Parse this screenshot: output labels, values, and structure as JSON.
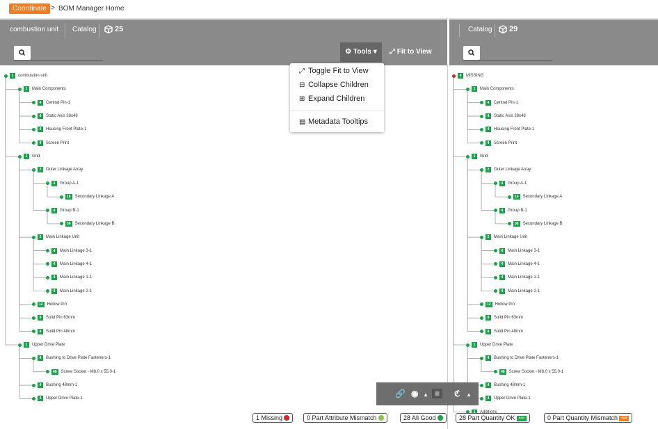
{
  "breadcrumb": {
    "app": "Coordinate",
    "separator": ">",
    "page": "BOM Manager Home"
  },
  "left_panel": {
    "title": "combustion unit",
    "catalog_label": "Catalog",
    "count": "25",
    "tools_label": "Tools",
    "fit_label": "Fit to View"
  },
  "right_panel": {
    "catalog_label": "Catalog",
    "count": "29"
  },
  "menu": {
    "items": [
      "Toggle Fit to View",
      "Collapse Children",
      "Expand Children",
      "Metadata Tooltips"
    ]
  },
  "colors": {
    "accent": "#f47b20",
    "ok": "#1aa34a",
    "missing": "#d9232a",
    "mismatch_dot": "#8bc34a",
    "header": "#8a8a8a"
  },
  "left_tree": [
    {
      "b": "1",
      "t": "combustion unit",
      "d": 0
    },
    {
      "b": "1",
      "t": "Main Components",
      "d": 1
    },
    {
      "b": "4",
      "t": "Central Pin-1",
      "d": 2
    },
    {
      "b": "4",
      "t": "Static Axis 28x48",
      "d": 2
    },
    {
      "b": "4",
      "t": "Housing Front Plate-1",
      "d": 2
    },
    {
      "b": "4",
      "t": "Screen Print",
      "d": 2
    },
    {
      "b": "1",
      "t": "Grid",
      "d": 1
    },
    {
      "b": "2",
      "t": "Outer Linkage Array",
      "d": 2
    },
    {
      "b": "4",
      "t": "Group A-1",
      "d": 3
    },
    {
      "b": "16",
      "t": "Secondary Linkage A",
      "d": 4
    },
    {
      "b": "4",
      "t": "Group B-1",
      "d": 3
    },
    {
      "b": "36",
      "t": "Secondary Linkage B",
      "d": 4
    },
    {
      "b": "2",
      "t": "Main Linkage Unit",
      "d": 2
    },
    {
      "b": "4",
      "t": "Main Linkage 3-1",
      "d": 3
    },
    {
      "b": "4",
      "t": "Main Linkage 4-1",
      "d": 3
    },
    {
      "b": "4",
      "t": "Main Linkage 1-1",
      "d": 3
    },
    {
      "b": "4",
      "t": "Main Linkage 2-1",
      "d": 3
    },
    {
      "b": "12",
      "t": "Hollow Pin",
      "d": 2
    },
    {
      "b": "8",
      "t": "Solid Pin 63mm",
      "d": 2
    },
    {
      "b": "8",
      "t": "Solid Pin 48mm",
      "d": 2
    },
    {
      "b": "1",
      "t": "Upper Drive Plate",
      "d": 1
    },
    {
      "b": "4",
      "t": "Bushing to Drive Plate Fasteners-1",
      "d": 2
    },
    {
      "b": "48",
      "t": "Screw Socket - M8.0 x 55.0-1",
      "d": 3
    },
    {
      "b": "4",
      "t": "Bushing 48mm-1",
      "d": 2
    },
    {
      "b": "4",
      "t": "Upper Drive Plate-1",
      "d": 2
    }
  ],
  "right_tree": [
    {
      "b": "0",
      "t": "MISSING",
      "d": 0
    },
    {
      "b": "1",
      "t": "Main Components",
      "d": 1
    },
    {
      "b": "4",
      "t": "Central Pin-1",
      "d": 2
    },
    {
      "b": "4",
      "t": "Static Axis 28x48",
      "d": 2
    },
    {
      "b": "4",
      "t": "Housing Front Plate-1",
      "d": 2
    },
    {
      "b": "4",
      "t": "Screen Print",
      "d": 2
    },
    {
      "b": "1",
      "t": "Grid",
      "d": 1
    },
    {
      "b": "2",
      "t": "Outer Linkage Array",
      "d": 2
    },
    {
      "b": "4",
      "t": "Group A-1",
      "d": 3
    },
    {
      "b": "16",
      "t": "Secondary Linkage A",
      "d": 4
    },
    {
      "b": "4",
      "t": "Group B-1",
      "d": 3
    },
    {
      "b": "36",
      "t": "Secondary Linkage B",
      "d": 4
    },
    {
      "b": "2",
      "t": "Main Linkage Unit",
      "d": 2
    },
    {
      "b": "4",
      "t": "Main Linkage 3-1",
      "d": 3
    },
    {
      "b": "4",
      "t": "Main Linkage 4-1",
      "d": 3
    },
    {
      "b": "4",
      "t": "Main Linkage 1-1",
      "d": 3
    },
    {
      "b": "4",
      "t": "Main Linkage 2-1",
      "d": 3
    },
    {
      "b": "12",
      "t": "Hollow Pin",
      "d": 2
    },
    {
      "b": "8",
      "t": "Solid Pin 63mm",
      "d": 2
    },
    {
      "b": "8",
      "t": "Solid Pin 48mm",
      "d": 2
    },
    {
      "b": "1",
      "t": "Upper Drive Plate",
      "d": 1
    },
    {
      "b": "4",
      "t": "Bushing to Drive Plate Fasteners-1",
      "d": 2
    },
    {
      "b": "48",
      "t": "Screw Socket - M8.0 x 55.0-1",
      "d": 3
    },
    {
      "b": "4",
      "t": "Bushing 48mm-1",
      "d": 2
    },
    {
      "b": "4",
      "t": "Upper Drive Plate-1",
      "d": 2
    },
    {
      "b": "1",
      "t": "Additions",
      "d": 1
    }
  ],
  "status": {
    "missing": "1 Missing",
    "mismatch": "0 Part Attribute Mismatch",
    "good": "28 All Good",
    "qty_ok": "28 Part Quantity OK",
    "qty_ok_badge": "###",
    "qty_mismatch": "0 Part Quantity Mismatch",
    "qty_mismatch_badge": "###"
  }
}
